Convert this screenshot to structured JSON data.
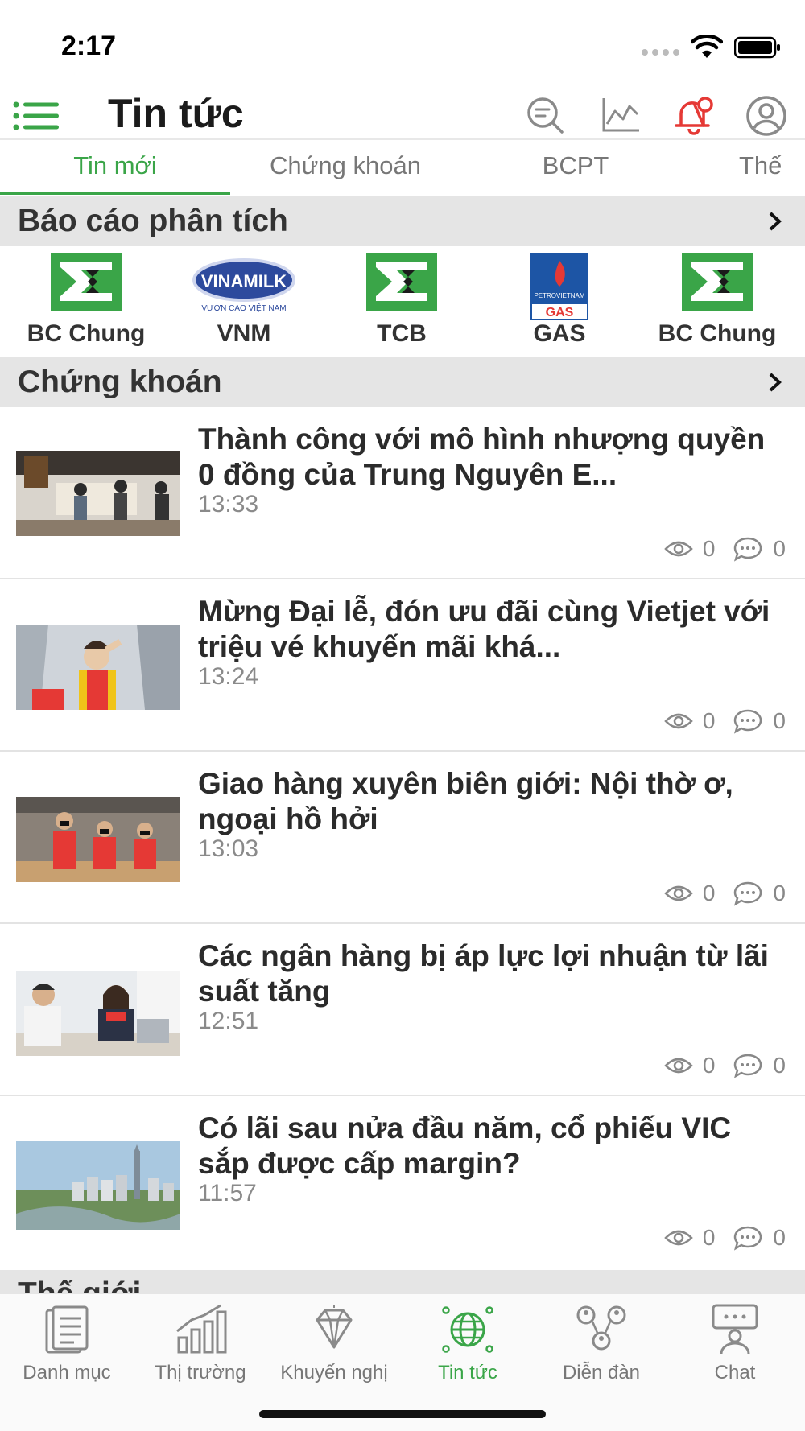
{
  "status_bar": {
    "time": "2:17"
  },
  "header": {
    "title": "Tin tức"
  },
  "tabs": [
    {
      "label": "Tin mới",
      "active": true
    },
    {
      "label": "Chứng khoán",
      "active": false
    },
    {
      "label": "BCPT",
      "active": false
    },
    {
      "label": "Thế",
      "active": false
    }
  ],
  "reports_section": {
    "title": "Báo cáo phân tích",
    "items": [
      {
        "label": "BC Chung",
        "logo": "sigma-logo"
      },
      {
        "label": "VNM",
        "logo": "vinamilk-logo",
        "logo_text": "VINAMILK",
        "logo_subtext": "VƯƠN CAO VIỆT NAM"
      },
      {
        "label": "TCB",
        "logo": "sigma-logo"
      },
      {
        "label": "GAS",
        "logo": "petrovietnam-gas-logo",
        "logo_text": "PETROVIETNAM",
        "logo_subtext": "GAS"
      },
      {
        "label": "BC Chung",
        "logo": "sigma-logo"
      }
    ]
  },
  "stocks_section": {
    "title": "Chứng khoán",
    "articles": [
      {
        "title": "Thành công với mô hình nhượng quyền 0 đồng của Trung Nguyên E...",
        "time": "13:33",
        "views": "0",
        "comments": "0"
      },
      {
        "title": "Mừng Đại lễ, đón ưu đãi cùng Vietjet với triệu vé khuyến mãi khá...",
        "time": "13:24",
        "views": "0",
        "comments": "0"
      },
      {
        "title": "Giao hàng xuyên biên giới: Nội thờ ơ, ngoại hồ hởi",
        "time": "13:03",
        "views": "0",
        "comments": "0"
      },
      {
        "title": "Các ngân hàng bị áp lực lợi nhuận từ lãi suất tăng",
        "time": "12:51",
        "views": "0",
        "comments": "0"
      },
      {
        "title": "Có lãi sau nửa đầu năm, cổ phiếu VIC sắp được cấp margin?",
        "time": "11:57",
        "views": "0",
        "comments": "0"
      }
    ]
  },
  "next_section": {
    "title": "Thế giới"
  },
  "bottom_nav": [
    {
      "label": "Danh mục",
      "icon": "clipboard-icon",
      "active": false
    },
    {
      "label": "Thị trường",
      "icon": "bar-chart-icon",
      "active": false
    },
    {
      "label": "Khuyến nghị",
      "icon": "diamond-icon",
      "active": false
    },
    {
      "label": "Tin tức",
      "icon": "globe-icon",
      "active": true
    },
    {
      "label": "Diễn đàn",
      "icon": "community-icon",
      "active": false
    },
    {
      "label": "Chat",
      "icon": "chat-icon",
      "active": false
    }
  ],
  "colors": {
    "accent": "#3aa548",
    "alert": "#e53935",
    "section_bg": "#e5e5e5"
  }
}
